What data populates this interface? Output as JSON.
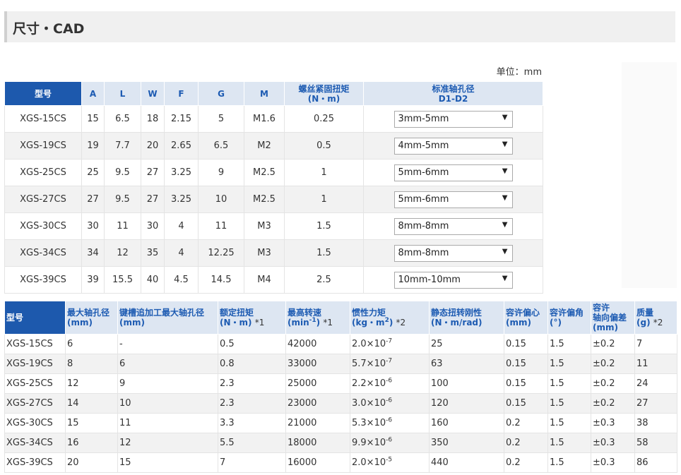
{
  "section_title": "尺寸・CAD",
  "unit_label": "单位：mm",
  "table1": {
    "headers": [
      "型号",
      "A",
      "L",
      "W",
      "F",
      "G",
      "M",
      "螺丝紧固扭矩",
      "(N・m)",
      "标准轴孔径",
      "D1-D2"
    ],
    "rows": [
      {
        "model": "XGS-15CS",
        "A": "15",
        "L": "6.5",
        "W": "18",
        "F": "2.15",
        "G": "5",
        "M": "M1.6",
        "torque": "0.25",
        "bore": "3mm-5mm"
      },
      {
        "model": "XGS-19CS",
        "A": "19",
        "L": "7.7",
        "W": "20",
        "F": "2.65",
        "G": "6.5",
        "M": "M2",
        "torque": "0.5",
        "bore": "4mm-5mm"
      },
      {
        "model": "XGS-25CS",
        "A": "25",
        "L": "9.5",
        "W": "27",
        "F": "3.25",
        "G": "9",
        "M": "M2.5",
        "torque": "1",
        "bore": "5mm-6mm"
      },
      {
        "model": "XGS-27CS",
        "A": "27",
        "L": "9.5",
        "W": "27",
        "F": "3.25",
        "G": "10",
        "M": "M2.5",
        "torque": "1",
        "bore": "5mm-6mm"
      },
      {
        "model": "XGS-30CS",
        "A": "30",
        "L": "11",
        "W": "30",
        "F": "4",
        "G": "11",
        "M": "M3",
        "torque": "1.5",
        "bore": "8mm-8mm"
      },
      {
        "model": "XGS-34CS",
        "A": "34",
        "L": "12",
        "W": "35",
        "F": "4",
        "G": "12.25",
        "M": "M3",
        "torque": "1.5",
        "bore": "8mm-8mm"
      },
      {
        "model": "XGS-39CS",
        "A": "39",
        "L": "15.5",
        "W": "40",
        "F": "4.5",
        "G": "14.5",
        "M": "M4",
        "torque": "2.5",
        "bore": "10mm-10mm"
      }
    ]
  },
  "table2": {
    "headers": {
      "model": "型号",
      "max_bore": "最大轴孔径",
      "max_bore_unit": "(mm)",
      "keyway_bore": "键槽追加工最大轴孔径",
      "keyway_bore_unit": "(mm)",
      "rated_torque": "额定扭矩",
      "rated_torque_unit": "(N・m)",
      "note1": "*1",
      "max_speed": "最高转速",
      "max_speed_unit": "(min",
      "max_speed_unit_sup": "-1",
      "max_speed_unit_end": ")",
      "note1b": "*1",
      "inertia": "惯性力矩",
      "inertia_unit": "(kg・m",
      "inertia_unit_sup": "2",
      "inertia_unit_end": ")",
      "note2": "*2",
      "stiffness": "静态扭转刚性",
      "stiffness_unit": "(N・m/rad)",
      "misalign": "容许偏心",
      "misalign_unit": "(mm)",
      "angle": "容许偏角",
      "angle_unit": "(°)",
      "axial": "容许",
      "axial2": "轴向偏差",
      "axial_unit": "(mm)",
      "mass": "质量",
      "mass_unit": "(g)",
      "note2b": "*2"
    },
    "rows": [
      {
        "model": "XGS-15CS",
        "max_bore": "6",
        "keyway": "-",
        "torque": "0.5",
        "speed": "42000",
        "inertia_base": "2.0×10",
        "inertia_exp": "-7",
        "stiff": "25",
        "ecc": "0.15",
        "angle": "1.5",
        "axial": "±0.2",
        "mass": "7"
      },
      {
        "model": "XGS-19CS",
        "max_bore": "8",
        "keyway": "6",
        "torque": "0.8",
        "speed": "33000",
        "inertia_base": "5.7×10",
        "inertia_exp": "-7",
        "stiff": "63",
        "ecc": "0.15",
        "angle": "1.5",
        "axial": "±0.2",
        "mass": "11"
      },
      {
        "model": "XGS-25CS",
        "max_bore": "12",
        "keyway": "9",
        "torque": "2.3",
        "speed": "25000",
        "inertia_base": "2.2×10",
        "inertia_exp": "-6",
        "stiff": "100",
        "ecc": "0.15",
        "angle": "1.5",
        "axial": "±0.2",
        "mass": "24"
      },
      {
        "model": "XGS-27CS",
        "max_bore": "14",
        "keyway": "10",
        "torque": "2.3",
        "speed": "23000",
        "inertia_base": "3.0×10",
        "inertia_exp": "-6",
        "stiff": "120",
        "ecc": "0.15",
        "angle": "1.5",
        "axial": "±0.2",
        "mass": "27"
      },
      {
        "model": "XGS-30CS",
        "max_bore": "15",
        "keyway": "11",
        "torque": "3.3",
        "speed": "21000",
        "inertia_base": "5.3×10",
        "inertia_exp": "-6",
        "stiff": "160",
        "ecc": "0.2",
        "angle": "1.5",
        "axial": "±0.3",
        "mass": "38"
      },
      {
        "model": "XGS-34CS",
        "max_bore": "16",
        "keyway": "12",
        "torque": "5.5",
        "speed": "18000",
        "inertia_base": "9.9×10",
        "inertia_exp": "-6",
        "stiff": "350",
        "ecc": "0.2",
        "angle": "1.5",
        "axial": "±0.3",
        "mass": "58"
      },
      {
        "model": "XGS-39CS",
        "max_bore": "20",
        "keyway": "15",
        "torque": "7",
        "speed": "16000",
        "inertia_base": "2.0×10",
        "inertia_exp": "-5",
        "stiff": "440",
        "ecc": "0.2",
        "angle": "1.5",
        "axial": "±0.3",
        "mass": "86"
      }
    ]
  },
  "select_arrow": "▼"
}
